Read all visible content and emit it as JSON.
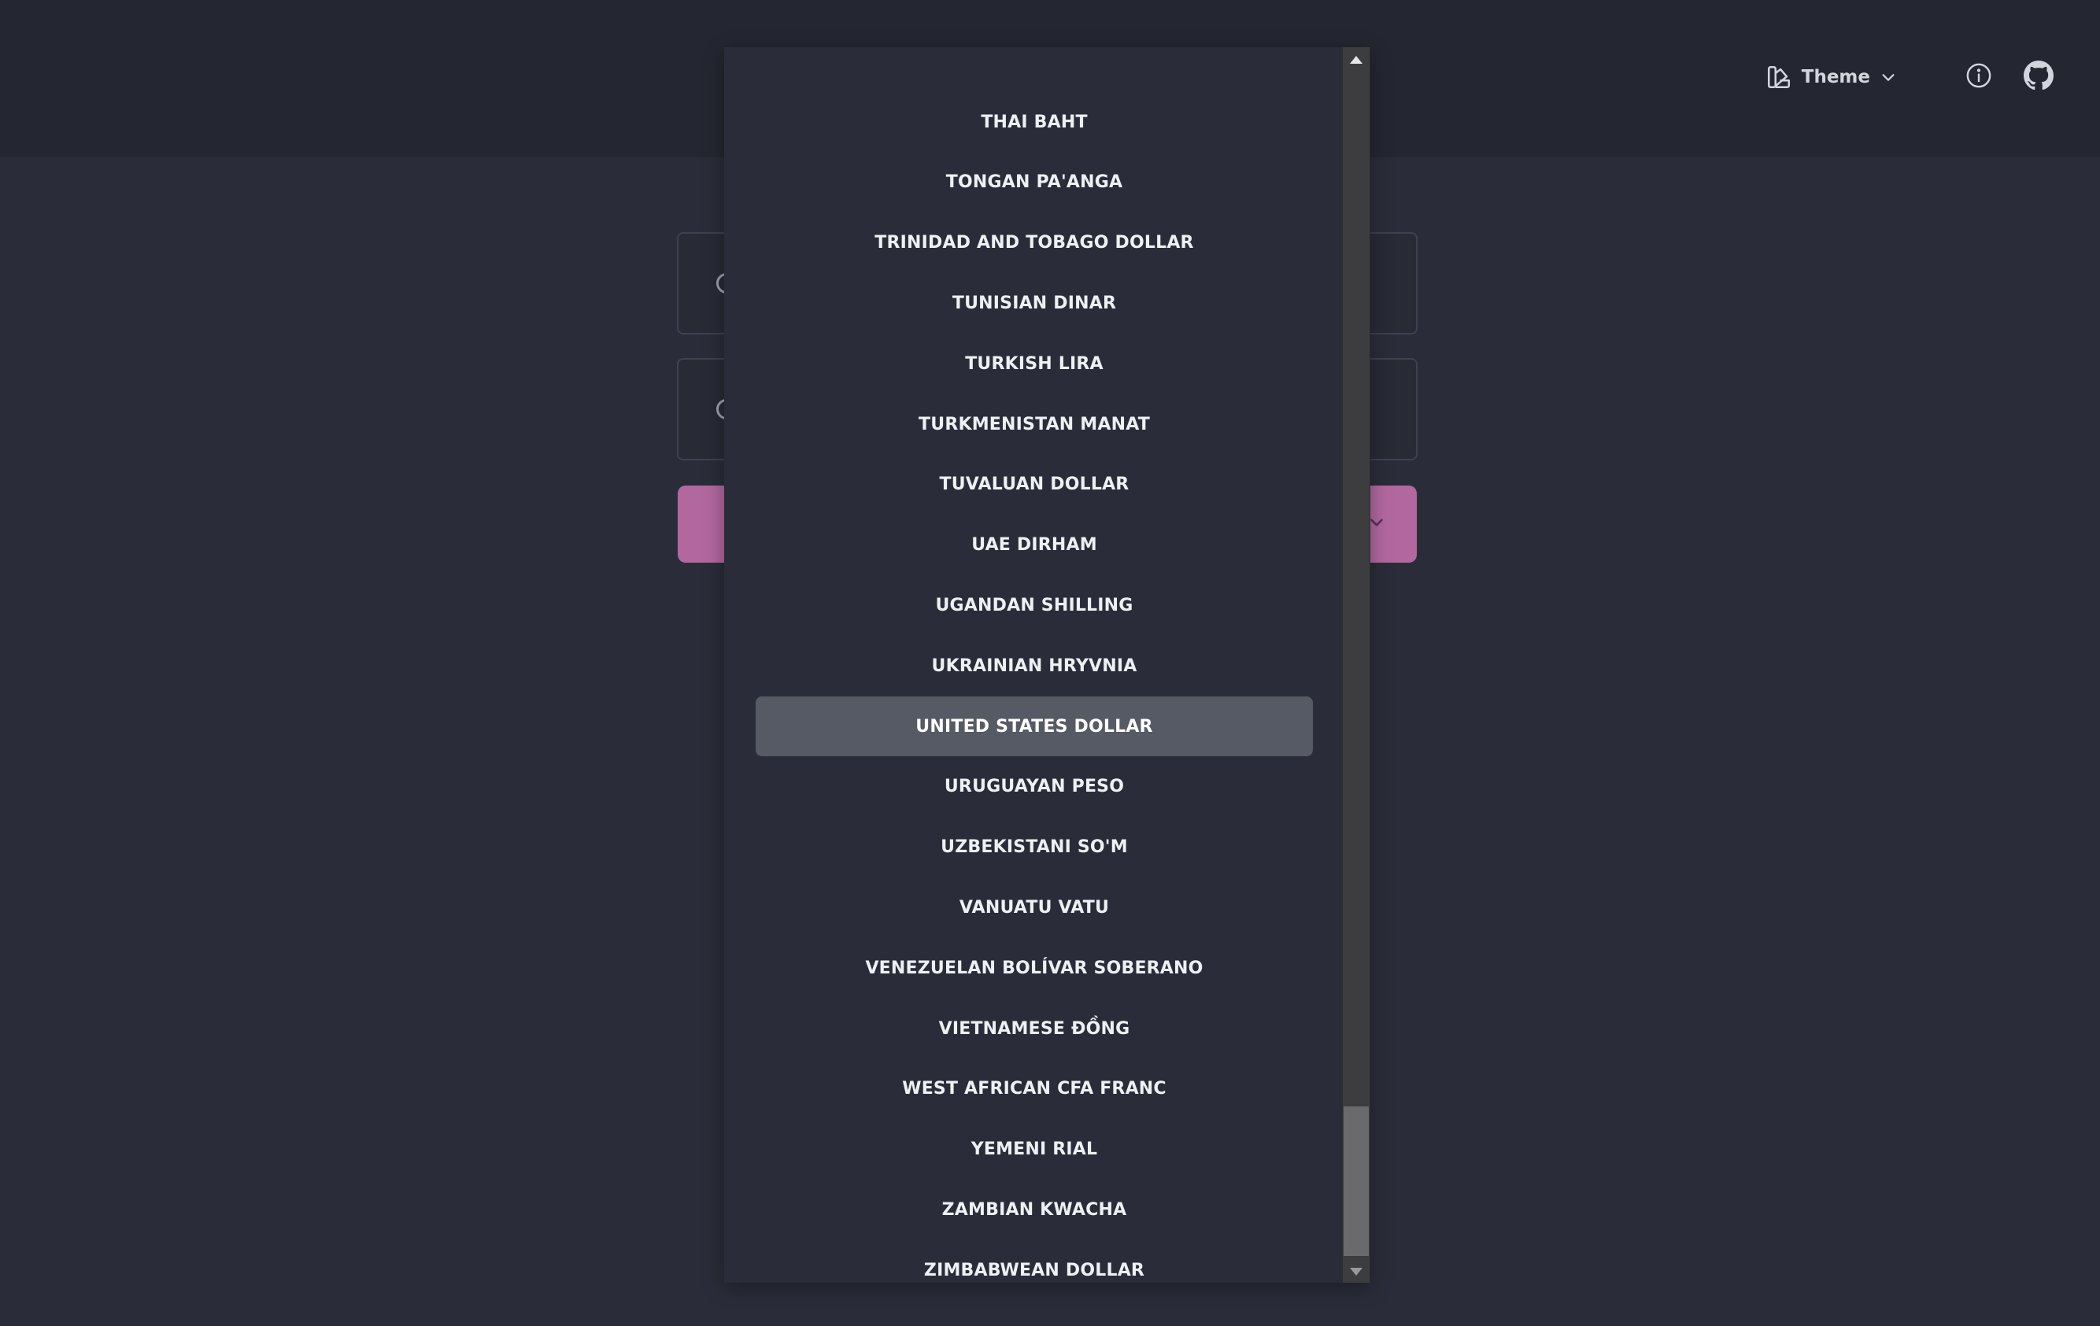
{
  "header": {
    "theme_label": "Theme"
  },
  "currency_dropdown": {
    "selected": "UNITED STATES DOLLAR",
    "options": [
      "THAI BAHT",
      "TONGAN PA'ANGA",
      "TRINIDAD AND TOBAGO DOLLAR",
      "TUNISIAN DINAR",
      "TURKISH LIRA",
      "TURKMENISTAN MANAT",
      "TUVALUAN DOLLAR",
      "UAE DIRHAM",
      "UGANDAN SHILLING",
      "UKRAINIAN HRYVNIA",
      "UNITED STATES DOLLAR",
      "URUGUAYAN PESO",
      "UZBEKISTANI SO'M",
      "VANUATU VATU",
      "VENEZUELAN BOLÍVAR SOBERANO",
      "VIETNAMESE ĐỒNG",
      "WEST AFRICAN CFA FRANC",
      "YEMENI RIAL",
      "ZAMBIAN KWACHA",
      "ZIMBABWEAN DOLLAR"
    ]
  },
  "icons": {
    "theme": "palette-icon",
    "theme_toggle": "chevron-down-icon",
    "info": "info-icon",
    "github": "github-icon",
    "scroll_up": "triangle-up-icon",
    "scroll_down": "triangle-down-icon"
  },
  "colors": {
    "background": "#2a2d39",
    "topbar": "#242731",
    "accent": "#b2689f",
    "selected_option": "#565a64",
    "text": "#eef0f4"
  }
}
